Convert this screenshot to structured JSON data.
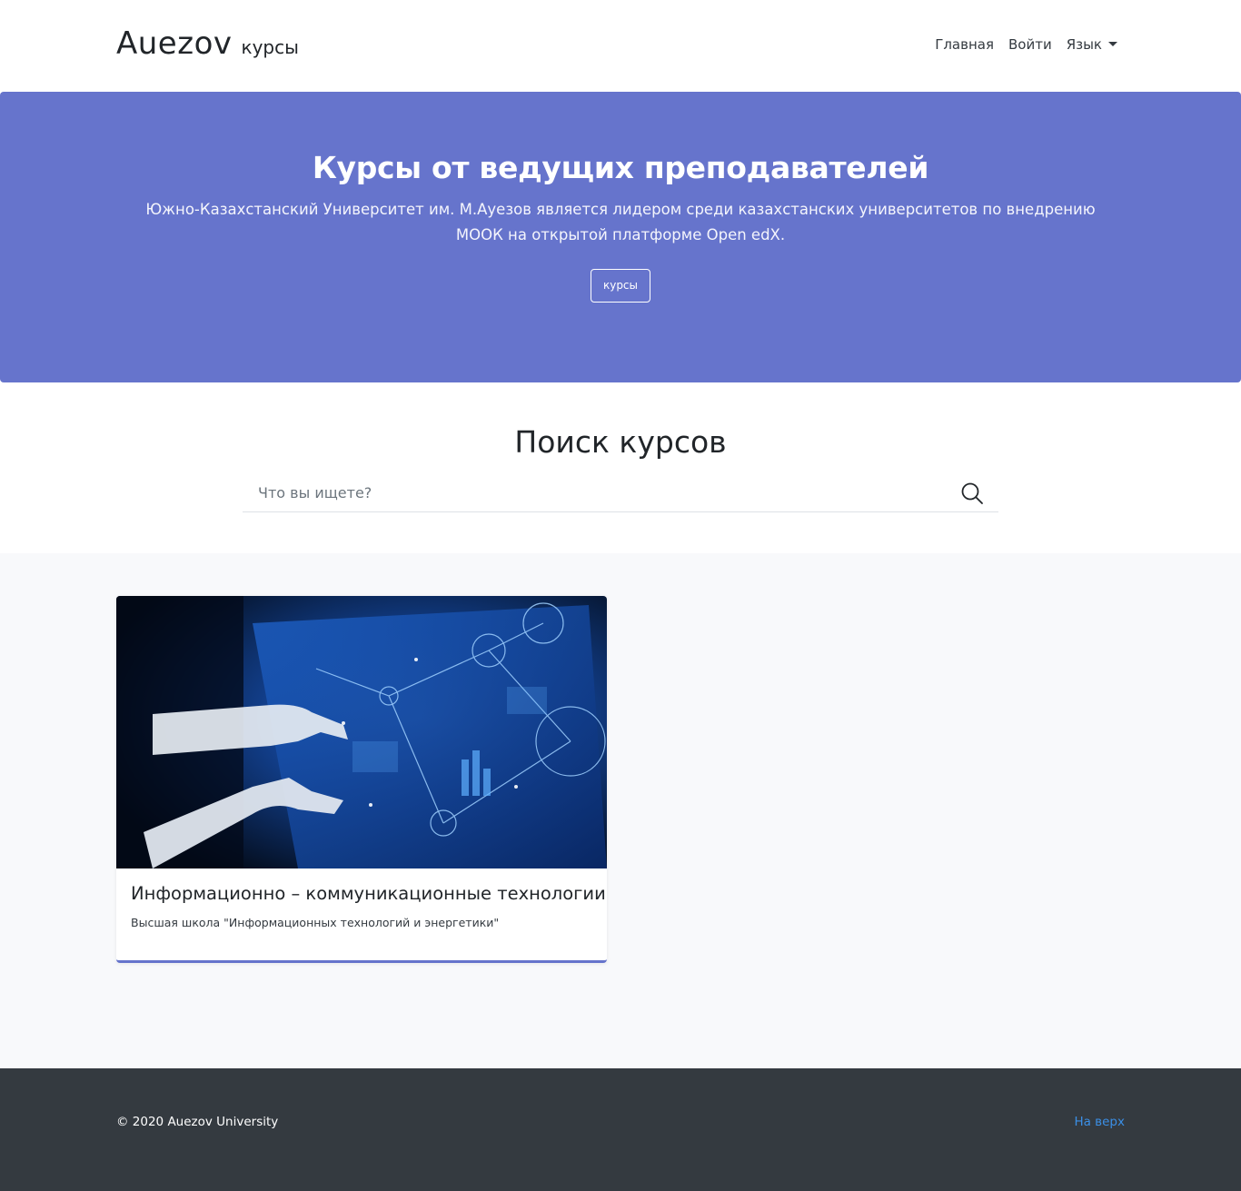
{
  "header": {
    "brand_main": "Auezov",
    "brand_sub": "курсы",
    "nav": {
      "home": "Главная",
      "login": "Войти",
      "language": "Язык"
    }
  },
  "hero": {
    "title": "Курсы от ведущих преподавателей",
    "text": "Южно-Казахстанский Университет им. М.Ауезов является лидером среди казахстанских университетов по внедрению МООК на открытой платформе Open edX.",
    "button": "курсы",
    "background_color": "#6674cc"
  },
  "search": {
    "title": "Поиск курсов",
    "placeholder": "Что вы ищете?",
    "icon": "search-icon"
  },
  "courses": [
    {
      "title": "Информационно – коммуникационные технологии",
      "subtitle": "Высшая школа \"Информационных технологий и энергетики\"",
      "image": "touchscreen-technology-image"
    }
  ],
  "footer": {
    "copyright": "© 2020 Auezov University",
    "to_top": "На верх",
    "link_color": "#3b8fe6"
  }
}
